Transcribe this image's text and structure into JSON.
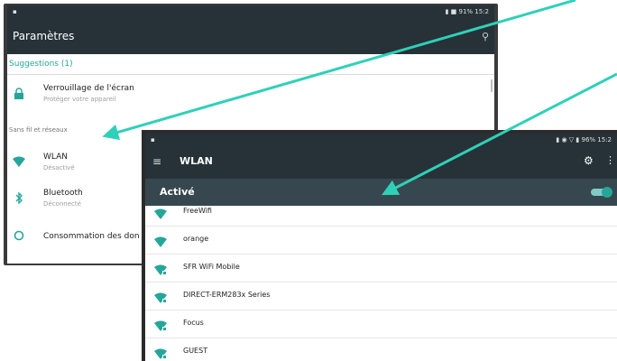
{
  "settings_screen": {
    "title": "Paramètres",
    "suggestions_header": "Suggestions (1)",
    "section_header": "Sans fil et réseaux",
    "items": [
      {
        "label": "Verrouillage de l'écran",
        "sub": "Protéger votre appareil",
        "icon": "lock-icon"
      },
      {
        "label": "WLAN",
        "sub": "Désactivé",
        "icon": "wifi-icon"
      },
      {
        "label": "Bluetooth",
        "sub": "Déconnecté",
        "icon": "bluetooth-icon"
      },
      {
        "label": "Consommation des don",
        "sub": "",
        "icon": "data-usage-icon"
      }
    ],
    "status_right": "▮ ■ 91% 15:2"
  },
  "wlan_screen": {
    "title": "WLAN",
    "toggle_label": "Activé",
    "toggle_on": true,
    "status_right": "▮ ◉ ▽ ▮ 96% 15:2",
    "networks": [
      {
        "name": "FreeWifi",
        "secured": false
      },
      {
        "name": "orange",
        "secured": false
      },
      {
        "name": "SFR WiFi Mobile",
        "secured": true
      },
      {
        "name": "DIRECT-ERM283x Series",
        "secured": true
      },
      {
        "name": "Focus",
        "secured": true
      },
      {
        "name": "GUEST",
        "secured": true
      }
    ]
  },
  "colors": {
    "accent": "#26a69a",
    "arrow": "#2fd0b8",
    "appbar": "#263238",
    "toggle_bar": "#37474f"
  }
}
